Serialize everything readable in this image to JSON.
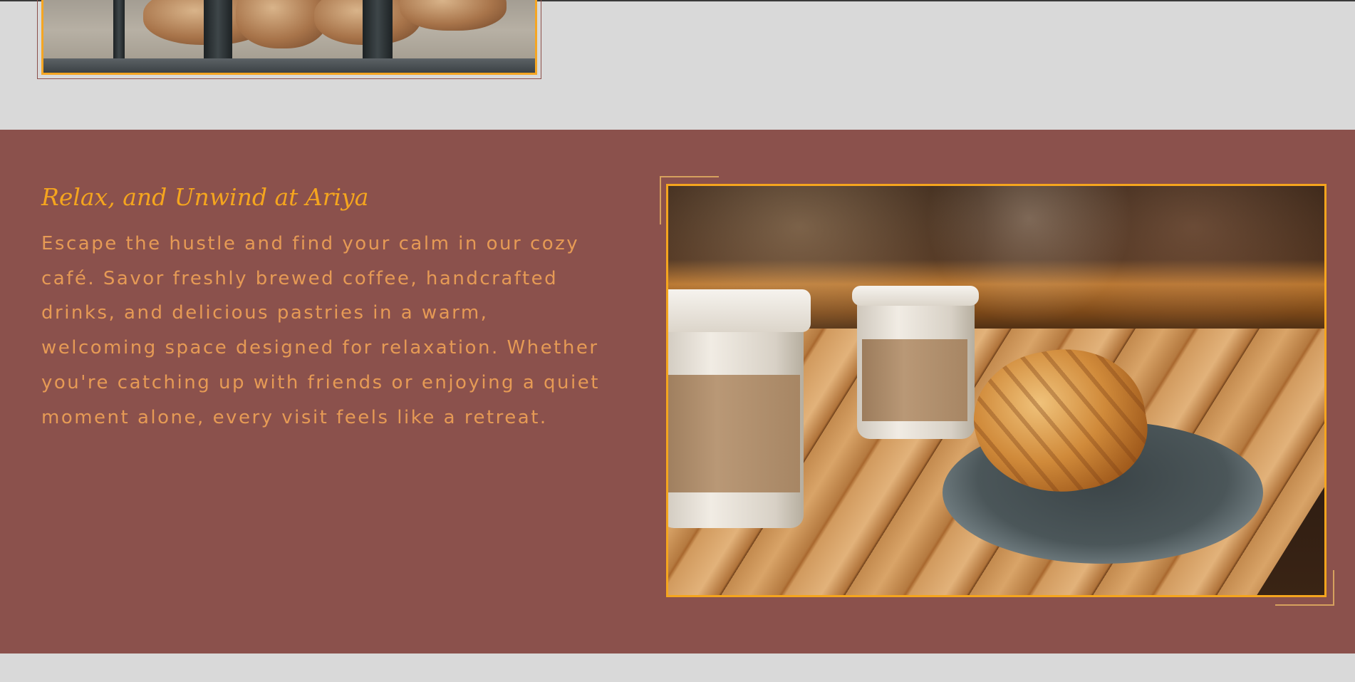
{
  "feature": {
    "title": "Relax, and Unwind at Ariya",
    "body": "Escape the hustle and find your calm in our cozy café. Savor freshly brewed coffee, handcrafted drinks, and delicious pastries in a warm, welcoming space designed for relaxation. Whether you're catching up with friends or enjoying a quiet moment alone, every visit feels like a retreat."
  },
  "colors": {
    "page_background": "#d9d9d9",
    "section_background": "#8b514c",
    "title_accent": "#f5a51e",
    "body_text": "#e69a55",
    "frame_border": "#f5a51e"
  },
  "images": {
    "top": "cinnamon-pastries-in-display-tray",
    "right": "coffee-cups-and-croissant-on-wooden-table"
  }
}
